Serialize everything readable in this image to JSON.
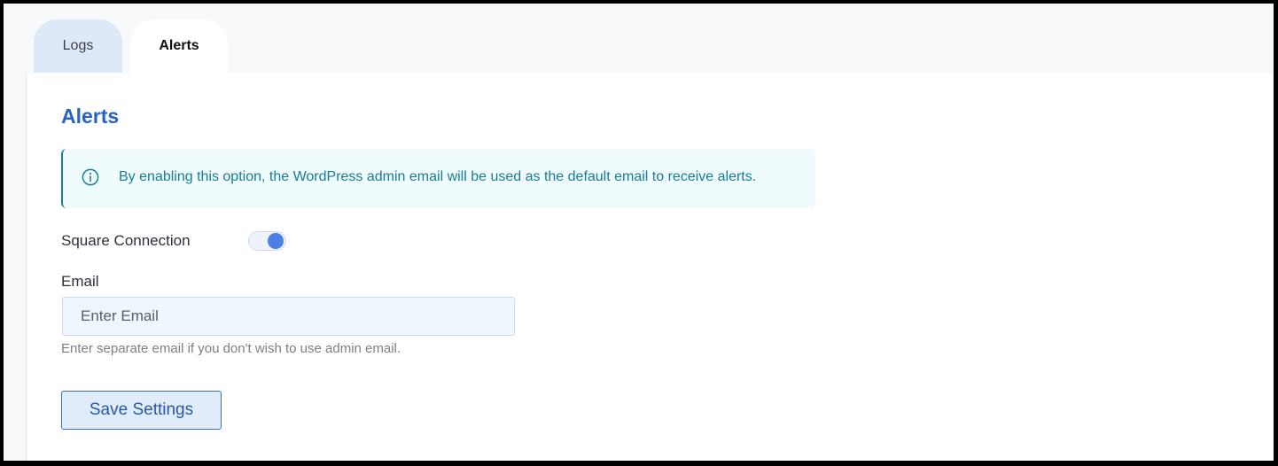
{
  "tabs": [
    {
      "label": "Logs",
      "active": false
    },
    {
      "label": "Alerts",
      "active": true
    }
  ],
  "panel": {
    "title": "Alerts",
    "notice": {
      "icon": "info-icon",
      "text": "By enabling this option, the WordPress admin email will be used as the default email to receive alerts."
    },
    "toggle": {
      "label": "Square Connection",
      "enabled": true
    },
    "email": {
      "label": "Email",
      "value": "",
      "placeholder": "Enter Email",
      "helper": "Enter separate email if you don't wish to use admin email."
    },
    "save_label": "Save Settings"
  },
  "colors": {
    "accent": "#2563c9",
    "notice_text": "#167d95",
    "notice_background": "#effbfd",
    "toggle_on": "#4d7fe6",
    "button_background": "#e1ecfb",
    "button_border": "#3a6fc3"
  }
}
